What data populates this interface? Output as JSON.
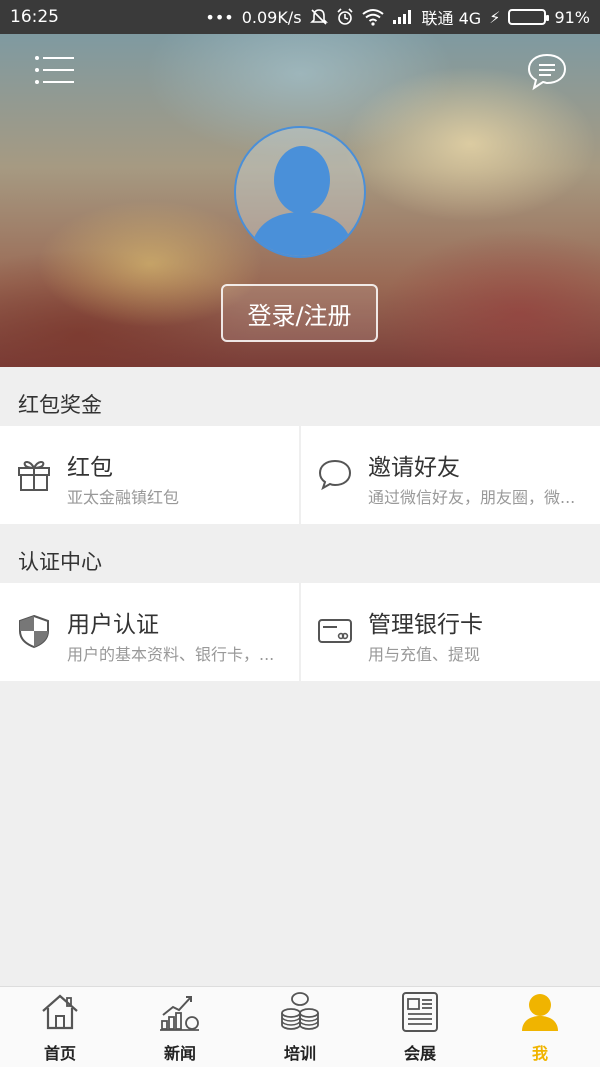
{
  "status_bar": {
    "time": "16:25",
    "network_speed": "0.09K/s",
    "carrier": "联通 4G",
    "battery": "91%",
    "battery_level": 0.91
  },
  "hero": {
    "login_button": "登录/注册"
  },
  "sections": [
    {
      "title": "红包奖金",
      "cards": [
        {
          "title": "红包",
          "subtitle": "亚太金融镇红包",
          "icon": "gift-icon"
        },
        {
          "title": "邀请好友",
          "subtitle": "通过微信好友，朋友圈，微...",
          "icon": "chat-bubble-icon"
        }
      ]
    },
    {
      "title": "认证中心",
      "cards": [
        {
          "title": "用户认证",
          "subtitle": "用户的基本资料、银行卡，...",
          "icon": "shield-icon"
        },
        {
          "title": "管理银行卡",
          "subtitle": "用与充值、提现",
          "icon": "bank-card-icon"
        }
      ]
    }
  ],
  "tabbar": {
    "tabs": [
      {
        "label": "首页",
        "icon": "home-icon"
      },
      {
        "label": "新闻",
        "icon": "news-chart-icon"
      },
      {
        "label": "培训",
        "icon": "coins-icon"
      },
      {
        "label": "会展",
        "icon": "newspaper-icon"
      },
      {
        "label": "我",
        "icon": "user-icon"
      }
    ],
    "active": "我",
    "active_color": "#f0b400"
  },
  "colors": {
    "avatar_blue": "#4a90d9",
    "battery_green": "#58d23a"
  }
}
